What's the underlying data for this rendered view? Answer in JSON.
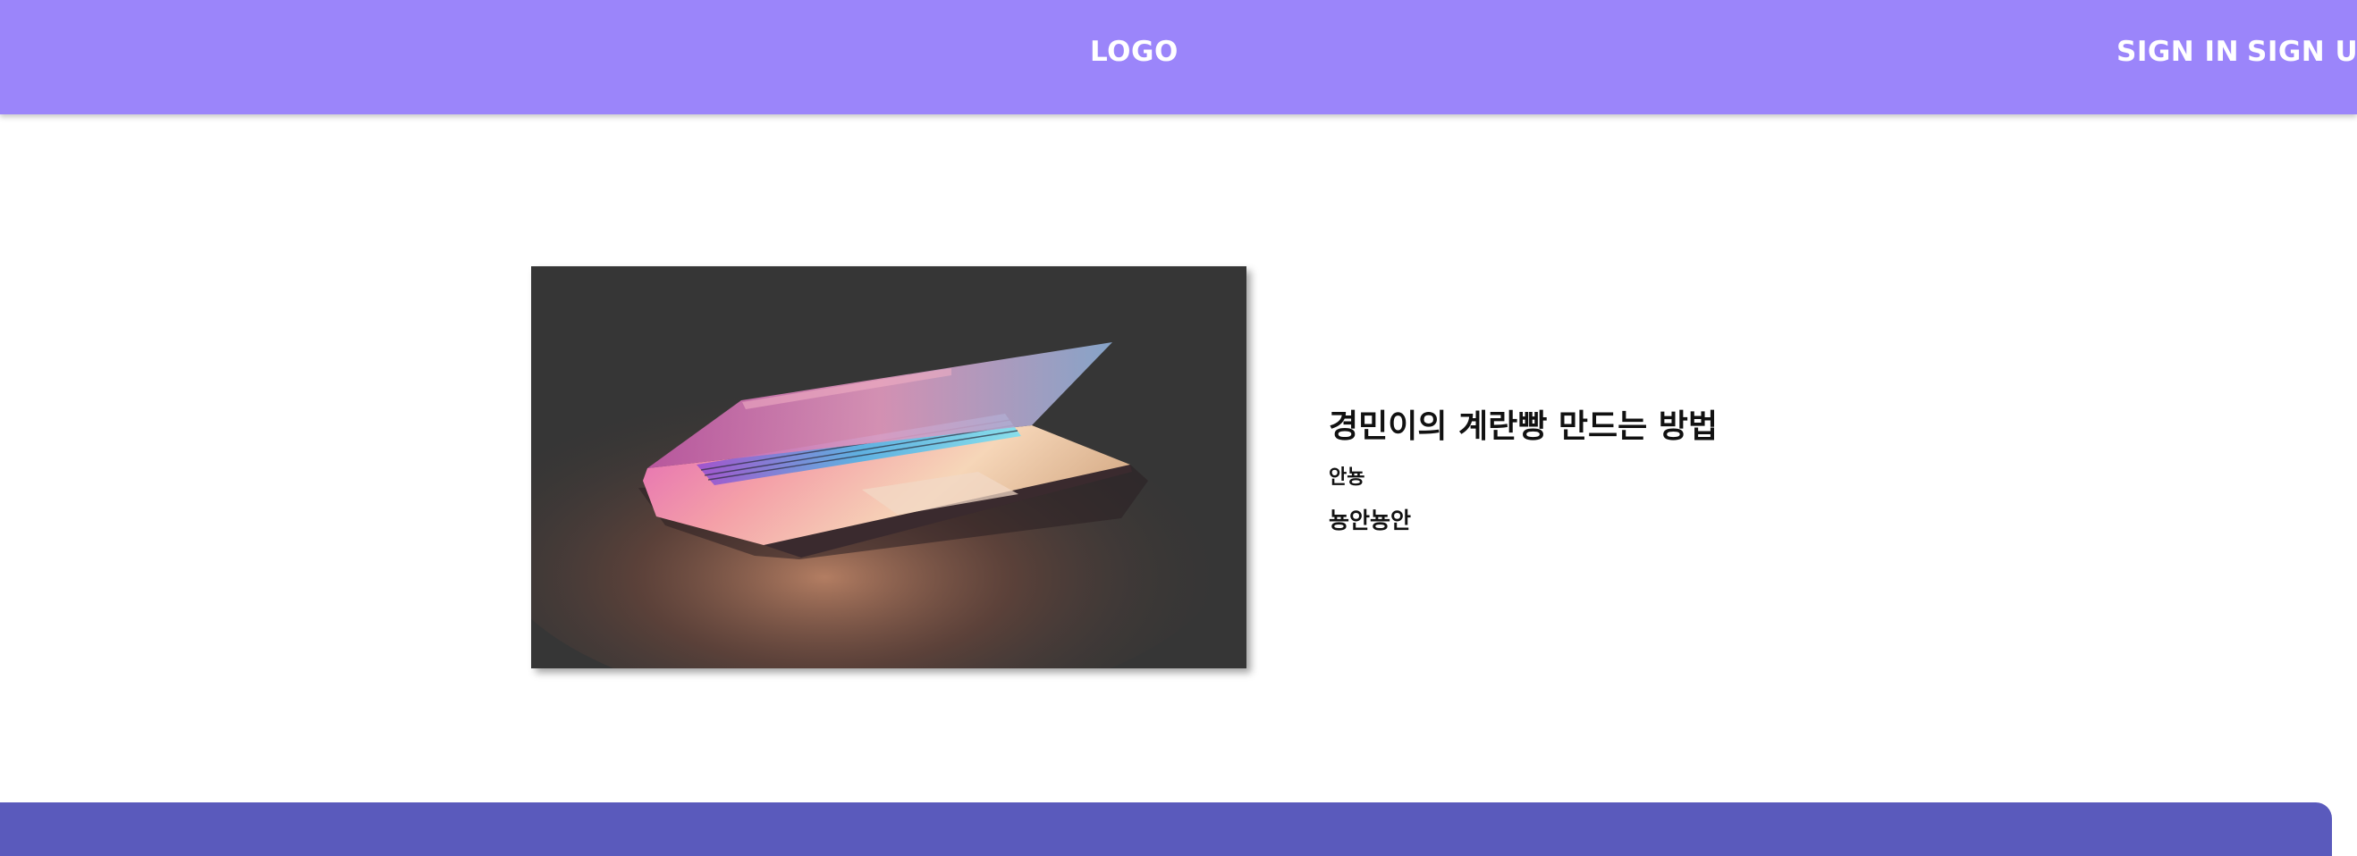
{
  "header": {
    "logo": "LOGO",
    "sign_in": "SIGN IN",
    "sign_up": "SIGN UP",
    "background_color": "#9b85fa"
  },
  "post": {
    "image_subject": "laptop-photo",
    "title": "경민이의 계란빵 만드는 방법",
    "author": "안뇽",
    "description": "뇽안뇽안"
  },
  "footer": {
    "background_color": "#5a5abc"
  }
}
